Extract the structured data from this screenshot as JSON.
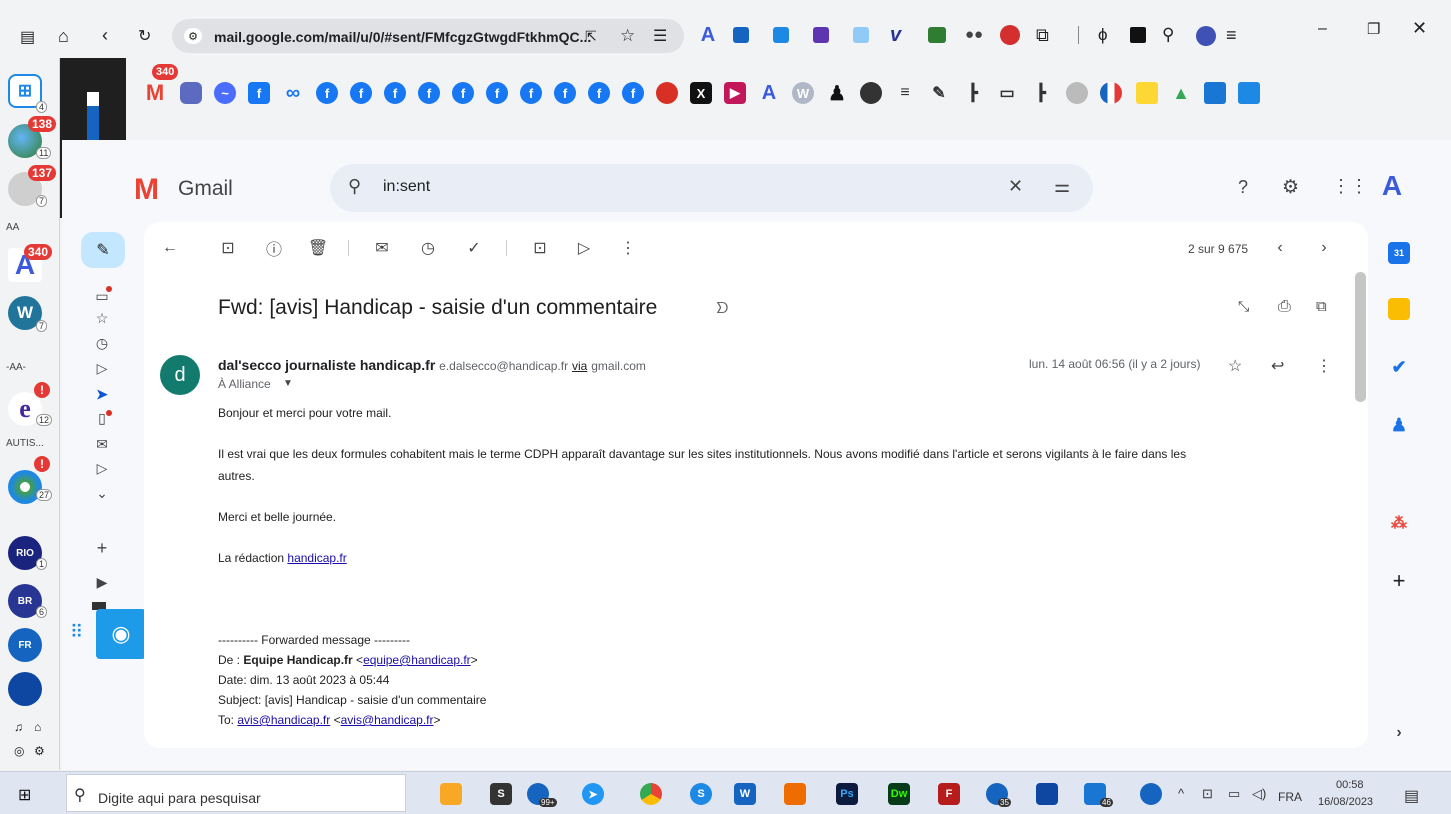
{
  "browser": {
    "url": "mail.google.com/mail/u/0/#sent/FMfcgzGtwgdFtkhmQC...",
    "bookmark_badge": "340"
  },
  "dock": {
    "badges": [
      "138",
      "137",
      "340"
    ],
    "counts": [
      "4",
      "11",
      "7",
      "7",
      "12",
      "27",
      "1",
      "6"
    ],
    "labels": [
      "AA",
      "-AA-",
      "AUTIS..."
    ]
  },
  "gmail": {
    "brand": "Gmail",
    "search_value": "in:sent",
    "pager": "2 sur 9 675",
    "subject": "Fwd: [avis] Handicap - saisie d'un commentaire",
    "avatar_letter": "d",
    "sender_name": "dal'secco journaliste handicap.fr",
    "sender_email": "e.dalsecco@handicap.fr",
    "via_label": "via",
    "via_domain": "gmail.com",
    "recipient": "À Alliance",
    "date": "lun. 14 août 06:56 (il y a 2 jours)",
    "body": {
      "line1": "Bonjour et merci pour votre mail.",
      "line2a": "Il est vrai que les deux formules cohabitent mais le terme CDPH apparaît davantage sur les sites institutionnels. Nous avons modifié dans l'article et serons vigilants à le faire dans les",
      "line2b": "autres.",
      "line3": "Merci et belle journée.",
      "sign_prefix": "La rédaction",
      "sign_link": "handicap.fr",
      "fwd_header": "---------- Forwarded message ---------",
      "from_label": "De :",
      "from_name": "Equipe Handicap.fr",
      "from_email": "equipe@handicap.fr",
      "date_line": "Date: dim. 13 août 2023 à 05:44",
      "subject_line": "Subject: [avis] Handicap - saisie d'un commentaire",
      "to_label": "To:",
      "to_name": "avis@handicap.fr",
      "to_email": "avis@handicap.fr"
    }
  },
  "taskbar": {
    "search_placeholder": "Digite aqui para pesquisar",
    "lang": "FRA",
    "time": "00:58",
    "date": "16/08/2023",
    "badges": [
      "99+",
      "35",
      "46"
    ]
  },
  "colors": {
    "accent": "#0b57d0",
    "avatar": "#137b6e",
    "badge_red": "#e53935",
    "facebook": "#1877f2"
  }
}
